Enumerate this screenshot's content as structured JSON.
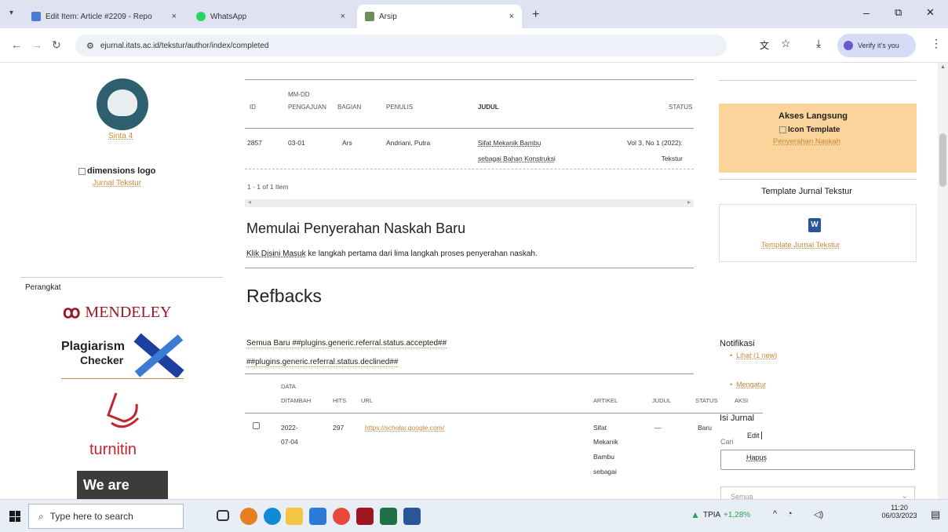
{
  "tabs": [
    {
      "label": "Edit Item: Article #2209 - Repo",
      "close": "×"
    },
    {
      "label": "WhatsApp",
      "close": "×"
    },
    {
      "label": "Arsip",
      "close": "×"
    }
  ],
  "new_tab": "+",
  "window_controls": {
    "minimize": "–",
    "restore": "⧉",
    "close": "✕"
  },
  "address": {
    "url": "ejurnal.itats.ac.id/tekstur/author/index/completed",
    "verify": "Verify it's you"
  },
  "sidebar": {
    "avatar_caption": "Sinta 4",
    "dimensions_logo": "dimensions logo",
    "dimensions_link": "Jurnal Tekstur",
    "perangkat": "Perangkat",
    "mendeley": "MENDELEY",
    "plagiarism_1": "Plagiarism",
    "plagiarism_2": "Checker",
    "turnitin": "turnitin",
    "we_are": "We are"
  },
  "submissions": {
    "header_top": "MM-DD",
    "columns": [
      "ID",
      "PENGAJUAN",
      "BAGIAN",
      "PENULIS",
      "JUDUL",
      "STATUS"
    ],
    "row": {
      "id": "2857",
      "date": "03-01",
      "section": "Ars",
      "authors": "Andriani, Putra",
      "title_1": "Sifat Mekanik Bambu",
      "title_2": "sebagai Bahan Konstruksi",
      "status_1": "Vol 3, No 1 (2022):",
      "status_2": "Tekstur"
    },
    "count": "1 - 1 of 1 Item"
  },
  "new_submission": {
    "heading": "Memulai Penyerahan Naskah Baru",
    "link": "Klik Disini Masuk",
    "text": "ke langkah pertama dari lima langkah proses penyerahan naskah."
  },
  "refbacks": {
    "heading": "Refbacks",
    "filter_1": "Semua Baru ##plugins.generic.referral.status.accepted##",
    "filter_2": "##plugins.generic.referral.status.declined##",
    "header_top": "DATA",
    "columns": [
      "DITAMBAH",
      "HITS",
      "URL",
      "ARTIKEL",
      "JUDUL",
      "STATUS",
      "AKSI"
    ],
    "row": {
      "date_1": "2022-",
      "date_2": "07-04",
      "hits": "297",
      "url": "https://scholar.google.com/",
      "article": [
        "Sifat",
        "Mekanik",
        "Bambu",
        "sebagai"
      ],
      "judul": "—",
      "status": "Baru",
      "action_edit": "Edit",
      "action_delete": "Hapus"
    }
  },
  "right": {
    "akses_title": "Akses Langsung",
    "icon_template": "Icon Template",
    "penyerahan": "Penyerahan Naskah",
    "template_title": "Template Jurnal Tekstur",
    "template_link": "Template Jurnal Tekstur",
    "notifikasi": "Notifikasi",
    "lihat": "Lihat (1 new)",
    "mengatur": "Mengatur",
    "isi_jurnal": "Isi Jurnal",
    "cari": "Cari",
    "semua": "Semua"
  },
  "taskbar": {
    "search": "Type here to search",
    "stock": "TPIA",
    "stock_change": "+1,28%",
    "time": "11:20",
    "date": "06/03/2023"
  },
  "colors": {
    "accent_link": "#c8893a",
    "akses_bg": "#fad49a",
    "tabbar_bg": "#dfe3f1"
  }
}
